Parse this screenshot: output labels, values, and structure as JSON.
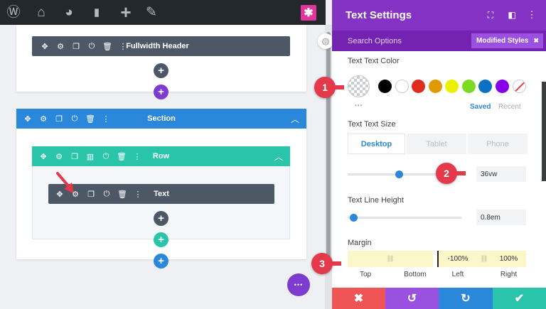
{
  "adminbar": {
    "icons": [
      "wordpress-icon",
      "home-icon",
      "dashboard-icon",
      "comment-icon",
      "plus-icon",
      "pencil-icon"
    ],
    "glyphs": [
      "Ⓦ",
      "⌂",
      "◕",
      "▮",
      "+",
      "✎"
    ],
    "divi_glyph": "✱"
  },
  "canvas": {
    "fullwidth_module": "Fullwidth Header",
    "section_label": "Section",
    "row_label": "Row",
    "text_module": "Text",
    "add_glyph": "+",
    "more_glyph": "•••"
  },
  "panel": {
    "title": "Text Settings",
    "search_placeholder": "Search Options",
    "modified_styles": "Modified Styles",
    "modified_close": "✖",
    "text_color_label": "Text Text Color",
    "colors": [
      "#000000",
      "#ffffff",
      "#e02b20",
      "#e09900",
      "#edf000",
      "#7cda24",
      "#0c71c3",
      "#8300e9"
    ],
    "color_tabs": {
      "saved": "Saved",
      "recent": "Recent"
    },
    "text_size_label": "Text Text Size",
    "device_tabs": [
      "Desktop",
      "Tablet",
      "Phone"
    ],
    "text_size_value": "36vw",
    "text_size_slider": 0.45,
    "line_height_label": "Text Line Height",
    "line_height_value": "0.8em",
    "line_height_slider": 0.02,
    "margin_label": "Margin",
    "margin_values": [
      "",
      "",
      "-100%",
      "100%"
    ],
    "margin_sides": [
      "Top",
      "Bottom",
      "Left",
      "Right"
    ],
    "footer": [
      {
        "name": "discard",
        "glyph": "✖",
        "color": "#ef5555"
      },
      {
        "name": "undo",
        "glyph": "↺",
        "color": "#9b51e0"
      },
      {
        "name": "redo",
        "glyph": "↻",
        "color": "#2b87da"
      },
      {
        "name": "save",
        "glyph": "✔",
        "color": "#29c4a9"
      }
    ]
  },
  "markers": [
    "1",
    "2",
    "3"
  ]
}
